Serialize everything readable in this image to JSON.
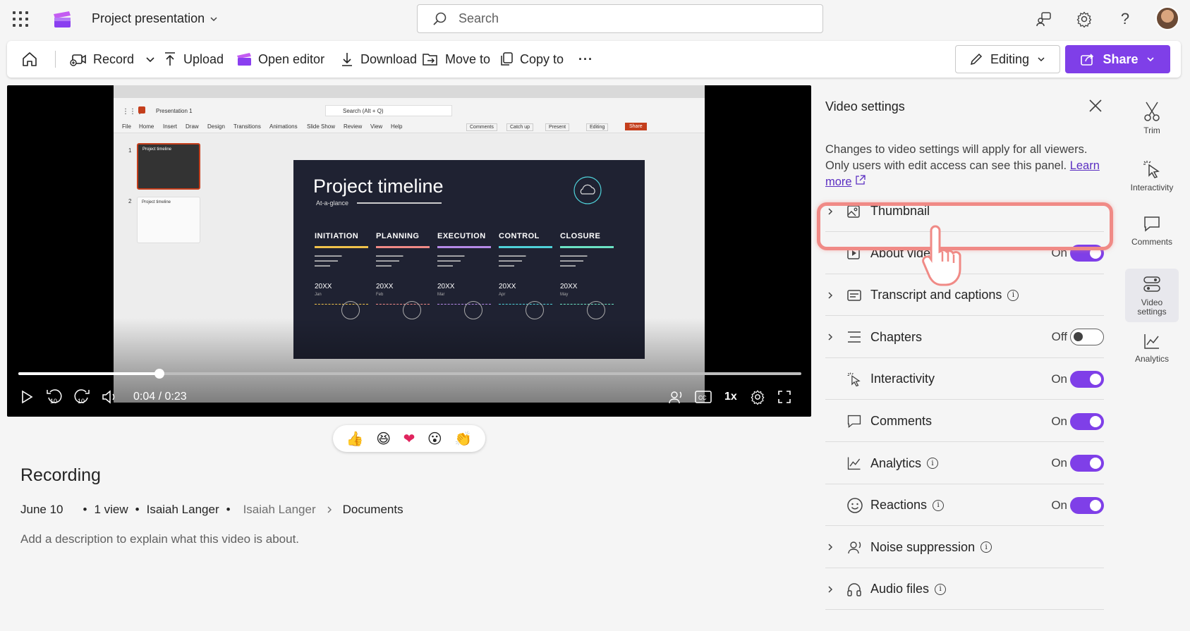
{
  "header": {
    "title": "Project presentation",
    "search_placeholder": "Search"
  },
  "commands": {
    "record": "Record",
    "upload": "Upload",
    "open_editor": "Open editor",
    "download": "Download",
    "move_to": "Move to",
    "copy_to": "Copy to",
    "more": "···",
    "editing": "Editing",
    "share": "Share"
  },
  "player": {
    "slide_title": "Project timeline",
    "slide_subtitle": "At-a-glance",
    "phases": [
      {
        "name": "INITIATION",
        "year": "20XX",
        "month": "Jan",
        "color": "#f0c24b"
      },
      {
        "name": "PLANNING",
        "year": "20XX",
        "month": "Feb",
        "color": "#f08a86"
      },
      {
        "name": "EXECUTION",
        "year": "20XX",
        "month": "Mar",
        "color": "#b58ae8"
      },
      {
        "name": "CONTROL",
        "year": "20XX",
        "month": "Apr",
        "color": "#4fd1d9"
      },
      {
        "name": "CLOSURE",
        "year": "20XX",
        "month": "May",
        "color": "#6be3c4"
      }
    ],
    "mini_app": {
      "doc_name": "Presentation 1",
      "search": "Search (Alt + Q)",
      "menu": [
        "File",
        "Home",
        "Insert",
        "Draw",
        "Design",
        "Transitions",
        "Animations",
        "Slide Show",
        "Review",
        "View",
        "Help"
      ],
      "comments": "Comments",
      "catch_up": "Catch up",
      "present": "Present",
      "editing": "Editing",
      "share": "Share",
      "thumb_label": "Project timeline"
    },
    "time": "0:04 / 0:23",
    "progress": 0.18,
    "speed": "1x",
    "skip_back": "10",
    "skip_fwd": "10"
  },
  "reactions": [
    "👍",
    "😆",
    "❤",
    "😮",
    "👏"
  ],
  "info": {
    "title": "Recording",
    "date": "June 10",
    "views": "1 view",
    "owner": "Isaiah Langer",
    "path_owner": "Isaiah Langer",
    "path_folder": "Documents",
    "description": "Add a description to explain what this video is about."
  },
  "panel": {
    "title": "Video settings",
    "desc": "Changes to video settings will apply for all viewers. Only users with edit access can see this panel.",
    "learn_more": "Learn more",
    "rows": [
      {
        "label": "Thumbnail",
        "state": "",
        "toggle": "none",
        "chevron": true
      },
      {
        "label": "About video",
        "state": "On",
        "toggle": "on",
        "chevron": false
      },
      {
        "label": "Transcript and captions",
        "state": "",
        "toggle": "none",
        "chevron": true
      },
      {
        "label": "Chapters",
        "state": "Off",
        "toggle": "off",
        "chevron": true
      },
      {
        "label": "Interactivity",
        "state": "On",
        "toggle": "on",
        "chevron": false
      },
      {
        "label": "Comments",
        "state": "On",
        "toggle": "on",
        "chevron": false
      },
      {
        "label": "Analytics",
        "state": "On",
        "toggle": "on",
        "chevron": false
      },
      {
        "label": "Reactions",
        "state": "On",
        "toggle": "on",
        "chevron": false
      },
      {
        "label": "Noise suppression",
        "state": "",
        "toggle": "none",
        "chevron": true
      },
      {
        "label": "Audio files",
        "state": "",
        "toggle": "none",
        "chevron": true
      }
    ]
  },
  "rail": {
    "trim": "Trim",
    "interactivity": "Interactivity",
    "comments": "Comments",
    "video_settings_1": "Video",
    "video_settings_2": "settings",
    "analytics": "Analytics"
  },
  "colors": {
    "accent": "#7f3fe8",
    "highlight": "#f08a86"
  }
}
